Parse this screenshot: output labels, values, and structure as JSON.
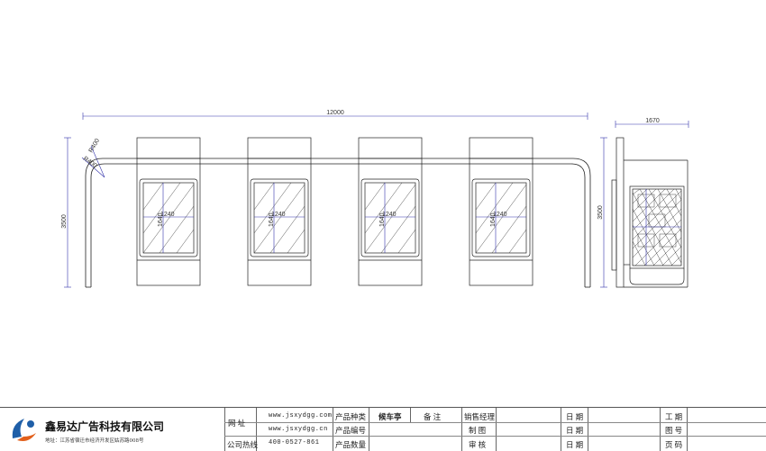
{
  "dimensions": {
    "overall_width": "12000",
    "side_width": "1670",
    "front_height": "3500",
    "side_height": "3500",
    "roof_r1": "R400",
    "roof_r2": "R400",
    "panel_width": "1240",
    "panel_height": "1640"
  },
  "title_block": {
    "company": "鑫易达广告科技有限公司",
    "address": "地址：江苏省宿迁市经济开发区姑苏路008号",
    "website_label": "网    址",
    "website_1": "www.jsxydgg.com",
    "website_2": "www.jsxydgg.cn",
    "hotline_label": "公司热线",
    "hotline": "400-0527-861",
    "product_type_label": "产品种类",
    "product_type": "候车亭",
    "product_no_label": "产品编号",
    "product_qty_label": "产品数量",
    "remark_label": "备    注",
    "sales_manager_label": "销售经理",
    "drafter_label": "制    图",
    "reviewer_label": "审    核",
    "date_label_1": "日  期",
    "date_label_2": "日  期",
    "date_label_3": "日  期",
    "project_label": "工  期",
    "drawing_no_label": "图  号",
    "page_label": "页  码"
  },
  "colors": {
    "dimension_line": "#3333aa",
    "outline": "#222222",
    "logo_blue": "#1f5fa8",
    "logo_orange": "#e2601c"
  }
}
